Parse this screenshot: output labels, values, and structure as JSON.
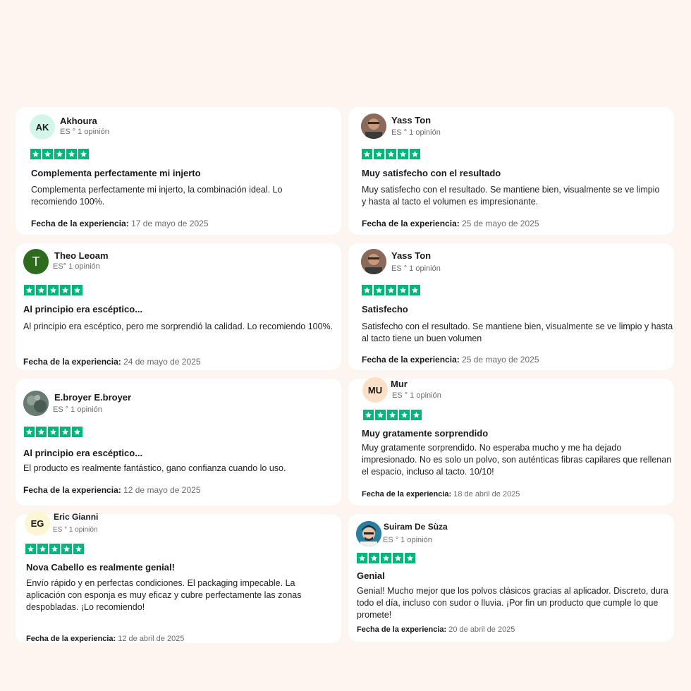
{
  "date_label": "Fecha de la experiencia:",
  "reviews": [
    {
      "name": "Akhoura",
      "initials": "AK",
      "meta": "ES ° 1 opinión",
      "rating": 5,
      "title": "Complementa perfectamente mi injerto",
      "body": "Complementa perfectamente mi injerto, la combinación ideal. Lo recomiendo 100%.",
      "date": "17 de mayo de 2025",
      "avatar_color": "#d4f5ea"
    },
    {
      "name": "Yass Ton",
      "initials": "",
      "meta": "ES ° 1 opinión",
      "rating": 5,
      "title": "Muy satisfecho con el resultado",
      "body": "Muy satisfecho con el resultado. Se mantiene bien, visualmente se ve limpio y hasta al tacto el volumen es impresionante.",
      "date": "25 de mayo de 2025",
      "avatar_color": "#7a5a4a"
    },
    {
      "name": "Theo Leoam",
      "initials": "T",
      "meta": "ES° 1 opinión",
      "rating": 5,
      "title": "Al principio era escéptico...",
      "body": "Al principio era escéptico, pero me sorprendió la calidad. Lo recomiendo 100%.",
      "date": "24 de mayo de 2025",
      "avatar_color": "#2e6b1e"
    },
    {
      "name": "Yass Ton",
      "initials": "",
      "meta": "ES ° 1 opinión",
      "rating": 5,
      "title": "Satisfecho",
      "body": "Satisfecho con el resultado. Se mantiene bien, visualmente se ve limpio y hasta al tacto tiene un buen volumen",
      "date": "25 de mayo de 2025",
      "avatar_color": "#7a5a4a"
    },
    {
      "name": "E.broyer E.broyer",
      "initials": "",
      "meta": "ES ° 1 opinión",
      "rating": 5,
      "title": "Al principio era escéptico...",
      "body": "El producto es realmente fantástico, gano confianza cuando lo uso.",
      "date": "12 de mayo de 2025",
      "avatar_color": "#5f7268"
    },
    {
      "name": "Mur",
      "initials": "MU",
      "meta": "ES ° 1 opinión",
      "rating": 5,
      "title": "Muy gratamente sorprendido",
      "body": "Muy gratamente sorprendido. No esperaba mucho y me ha dejado impresionado. No es solo un polvo, son auténticas fibras capilares que rellenan el espacio, incluso al tacto. 10/10!",
      "date": "18 de abril de 2025",
      "avatar_color": "#fbe0c8"
    },
    {
      "name": "Eric Gianni",
      "initials": "EG",
      "meta": "ES ° 1 opinión",
      "rating": 5,
      "title": "Nova Cabello es realmente genial!",
      "body": "Envío rápido y en perfectas condiciones. El packaging impecable. La aplicación con esponja es muy eficaz y cubre perfectamente las zonas despobladas. ¡Lo recomiendo!",
      "date": "12 de abril de 2025",
      "avatar_color": "#fdf6d4"
    },
    {
      "name": "Suiram De Sùza",
      "initials": "",
      "meta": "ES ° 1 opinión",
      "rating": 5,
      "title": "Genial",
      "body": "Genial! Mucho mejor que los polvos clásicos gracias al aplicador. Discreto, dura todo el día, incluso con sudor o lluvia. ¡Por fin un producto que cumple lo que promete!",
      "date": "20 de abril de 2025",
      "avatar_color": "#1f6f8f"
    }
  ]
}
